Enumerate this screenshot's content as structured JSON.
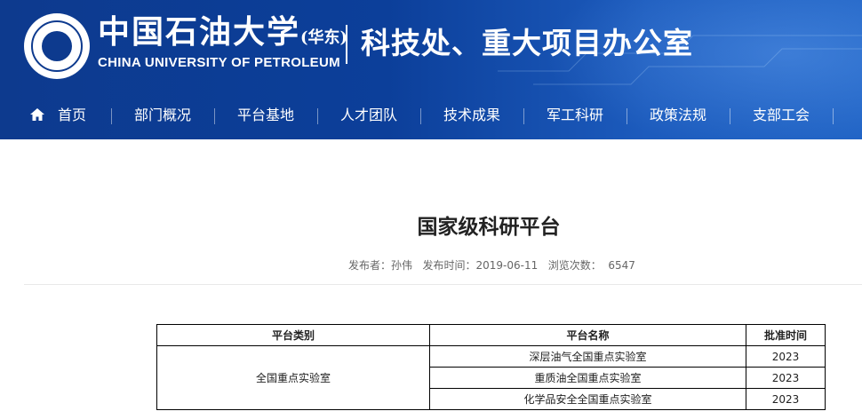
{
  "header": {
    "university_cn": "中国石油大学",
    "university_cn_sub": "(华东)",
    "university_en": "CHINA UNIVERSITY OF PETROLEUM",
    "office_name": "科技处、重大项目办公室"
  },
  "nav": {
    "items": [
      {
        "label": "首页",
        "icon": "home-icon"
      },
      {
        "label": "部门概况"
      },
      {
        "label": "平台基地"
      },
      {
        "label": "人才团队"
      },
      {
        "label": "技术成果"
      },
      {
        "label": "军工科研"
      },
      {
        "label": "政策法规"
      },
      {
        "label": "支部工会"
      }
    ]
  },
  "article": {
    "title": "国家级科研平台",
    "publisher_label": "发布者：",
    "publisher": "孙伟",
    "date_label": "发布时间：",
    "date": "2019-06-11",
    "views_label": "浏览次数：",
    "views": "6547"
  },
  "table": {
    "headers": [
      "平台类别",
      "平台名称",
      "批准时间"
    ],
    "group": "全国重点实验室",
    "rows": [
      {
        "name": "深层油气全国重点实验室",
        "year": "2023"
      },
      {
        "name": "重质油全国重点实验室",
        "year": "2023"
      },
      {
        "name": "化学品安全全国重点实验室",
        "year": "2023"
      }
    ]
  },
  "colors": {
    "header_bg": "#0d3a8e",
    "header_accent": "#1f62c4",
    "text": "#222222"
  }
}
